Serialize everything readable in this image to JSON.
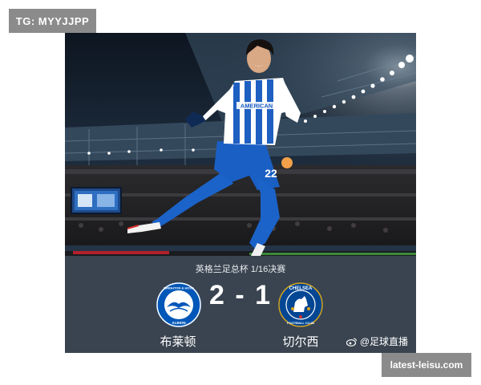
{
  "watermark_top": "TG: MYYJJPP",
  "watermark_bottom": "latest-leisu.com",
  "photo": {
    "jersey_sponsor": "AMERICAN",
    "shirt_number": "22"
  },
  "match": {
    "competition": "英格兰足总杯 1/16决赛",
    "score": "2 - 1",
    "home_team": "布莱顿",
    "away_team": "切尔西",
    "source": "@足球直播"
  },
  "badges": {
    "home_top": "BRIGHTON & HOVE",
    "home_bottom": "ALBION",
    "away_top": "CHELSEA",
    "away_bottom": "FOOTBALL CLUB"
  },
  "colors": {
    "brighton_blue": "#0057b8",
    "chelsea_blue": "#034694",
    "panel_bg": "#3a4450"
  },
  "icons": [
    "weibo-icon"
  ]
}
